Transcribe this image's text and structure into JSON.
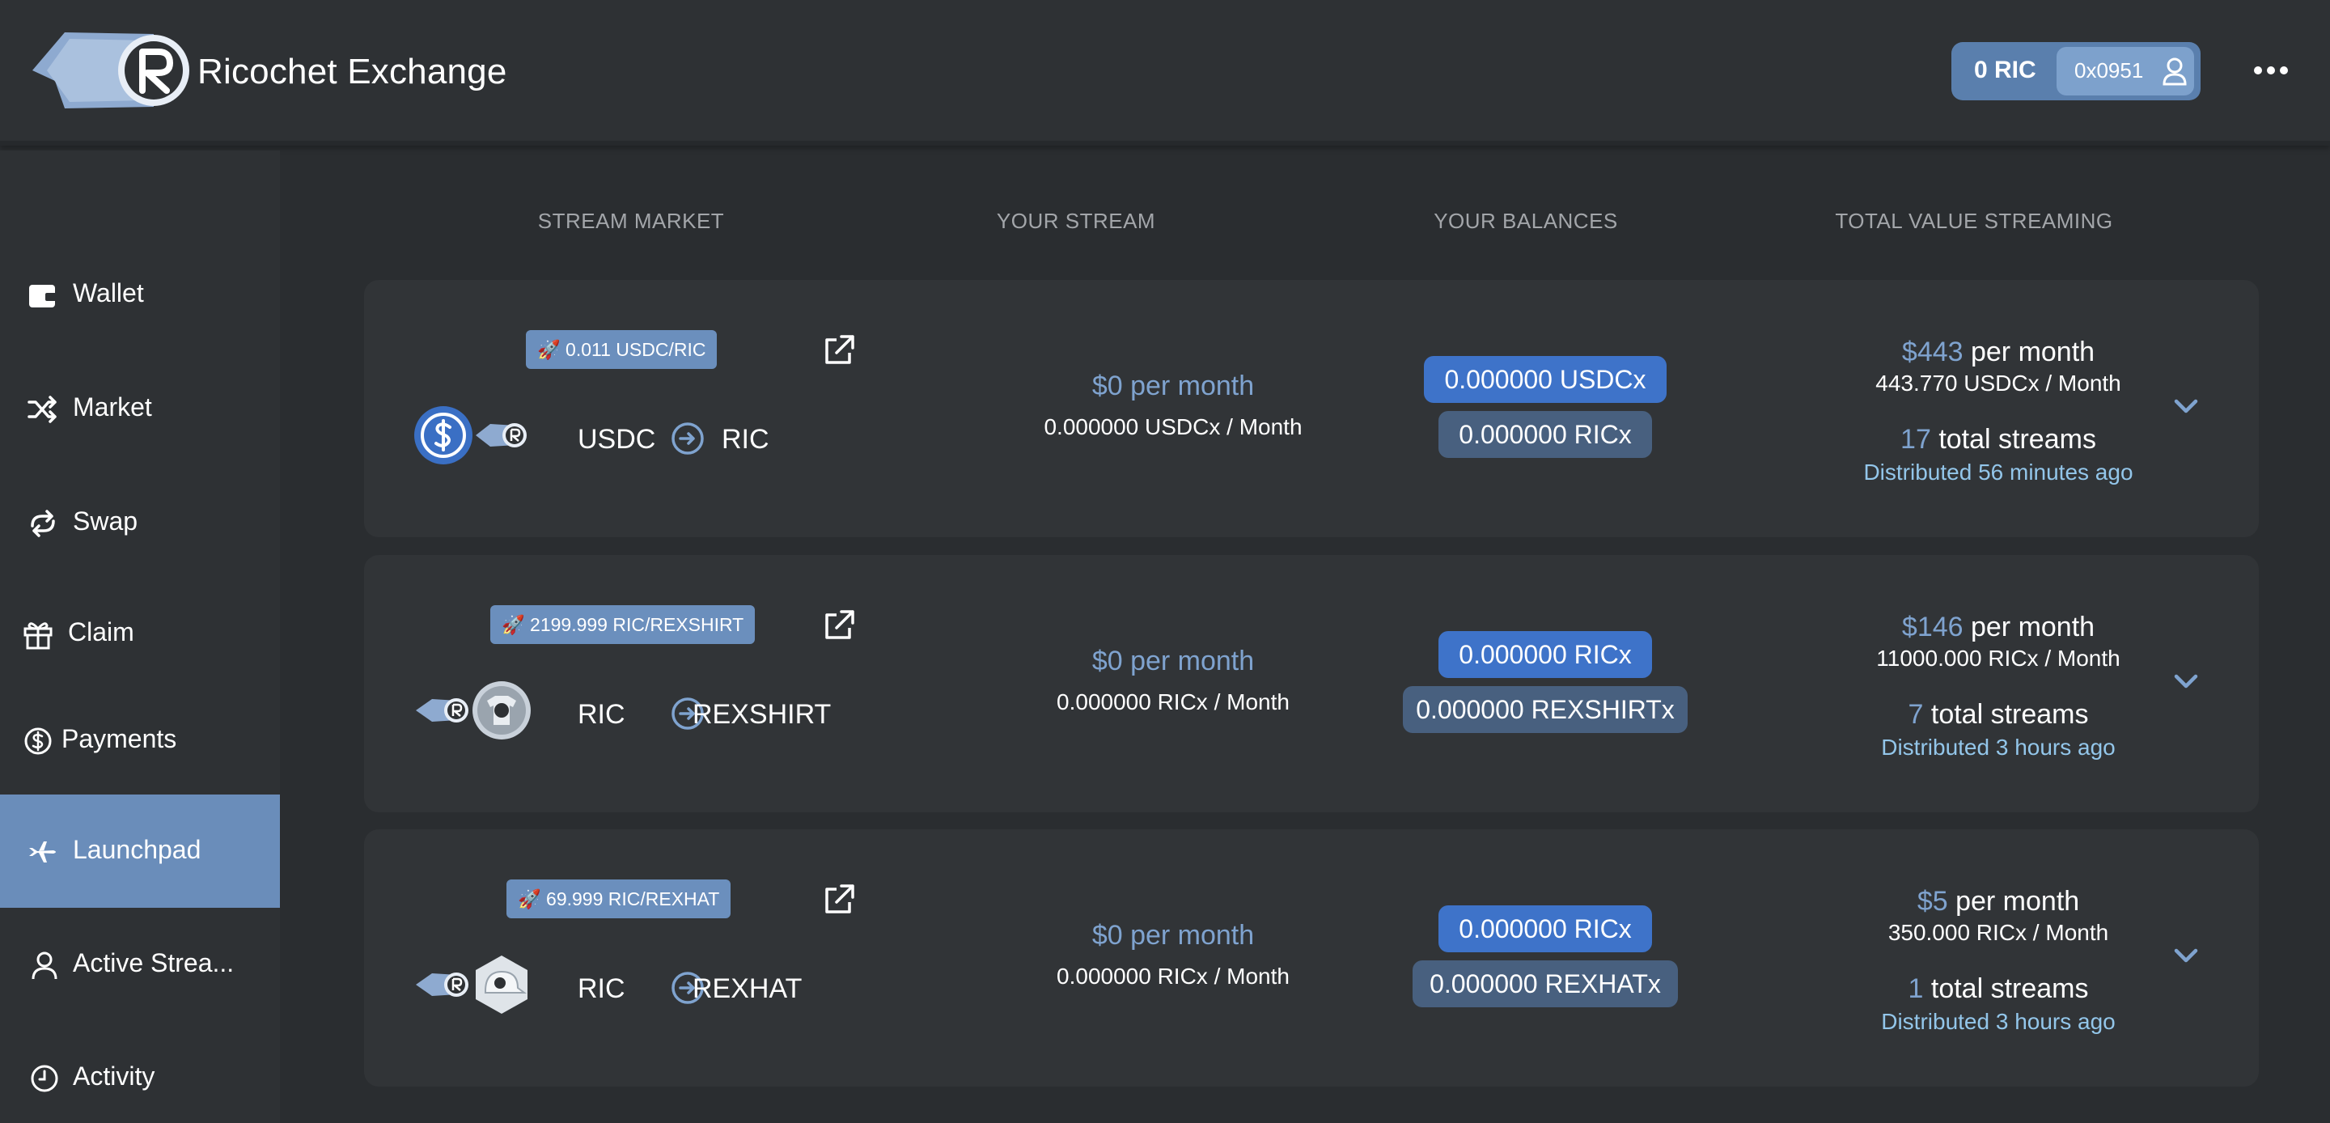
{
  "header": {
    "app_title": "Ricochet Exchange",
    "ric_balance": "0 RIC",
    "address": "0x0951"
  },
  "sidebar": {
    "items": [
      {
        "label": "Wallet",
        "icon": "wallet-icon"
      },
      {
        "label": "Market",
        "icon": "shuffle-icon"
      },
      {
        "label": "Swap",
        "icon": "swap-icon"
      },
      {
        "label": "Claim",
        "icon": "gift-icon"
      },
      {
        "label": "Payments",
        "icon": "dollar-circle-icon"
      },
      {
        "label": "Launchpad",
        "icon": "jet-icon",
        "active": true
      },
      {
        "label": "Active Strea...",
        "icon": "user-icon"
      },
      {
        "label": "Activity",
        "icon": "clock-icon"
      }
    ]
  },
  "columns": {
    "stream_market": "STREAM MARKET",
    "your_stream": "YOUR STREAM",
    "your_balances": "YOUR BALANCES",
    "total_value_streaming": "TOTAL VALUE STREAMING"
  },
  "markets": [
    {
      "price_badge": "🚀 0.011 USDC/RIC",
      "from_token": "USDC",
      "to_token": "RIC",
      "stream_rate": "$0 per month",
      "stream_amount": "0.000000 USDCx / Month",
      "balance_primary": "0.000000  USDCx",
      "balance_secondary": "0.000000  RICx",
      "total_value": "$443",
      "total_value_suffix": " per month",
      "total_tokens": "443.770 USDCx / Month",
      "total_streams_count": "17",
      "total_streams_suffix": " total streams",
      "distributed": "Distributed 56 minutes ago"
    },
    {
      "price_badge": "🚀 2199.999 RIC/REXSHIRT",
      "from_token": "RIC",
      "to_token": "REXSHIRT",
      "stream_rate": "$0 per month",
      "stream_amount": "0.000000 RICx / Month",
      "balance_primary": "0.000000  RICx",
      "balance_secondary": "0.000000  REXSHIRTx",
      "total_value": "$146",
      "total_value_suffix": " per month",
      "total_tokens": "11000.000 RICx / Month",
      "total_streams_count": "7",
      "total_streams_suffix": " total streams",
      "distributed": "Distributed 3 hours ago"
    },
    {
      "price_badge": "🚀 69.999 RIC/REXHAT",
      "from_token": "RIC",
      "to_token": "REXHAT",
      "stream_rate": "$0 per month",
      "stream_amount": "0.000000 RICx / Month",
      "balance_primary": "0.000000  RICx",
      "balance_secondary": "0.000000  REXHATx",
      "total_value": "$5",
      "total_value_suffix": " per month",
      "total_tokens": "350.000 RICx / Month",
      "total_streams_count": "1",
      "total_streams_suffix": " total streams",
      "distributed": "Distributed 3 hours ago"
    }
  ],
  "colors": {
    "background": "#2a2d30",
    "accent": "#7fa3cf",
    "active_nav": "#6a8dba",
    "balance_primary": "#3e73c9",
    "balance_secondary": "#48607f"
  }
}
